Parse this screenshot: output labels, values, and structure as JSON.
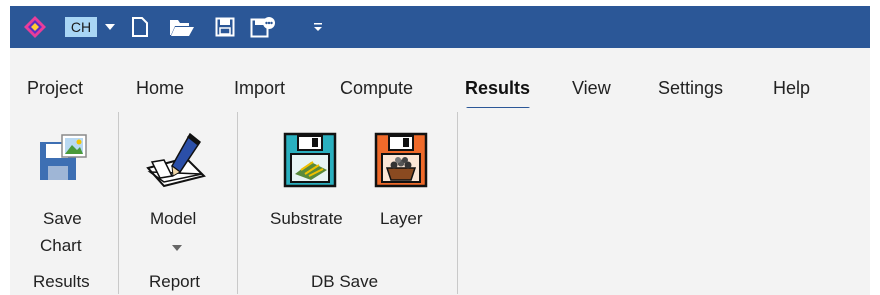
{
  "quick_access": {
    "profile_badge": "CH",
    "icons": [
      "app-logo-icon",
      "profile-badge",
      "dropdown-arrow-icon",
      "new-file-icon",
      "open-folder-icon",
      "save-icon",
      "save-remote-icon",
      "customize-toolbar-icon"
    ]
  },
  "menu": {
    "tabs": [
      "Project",
      "Home",
      "Import",
      "Compute",
      "Results",
      "View",
      "Settings",
      "Help"
    ],
    "active": "Results"
  },
  "ribbon": {
    "groups": [
      {
        "name": "Results",
        "buttons": [
          {
            "line1": "Save",
            "line2": "Chart",
            "icon": "save-chart-icon"
          }
        ]
      },
      {
        "name": "Report",
        "buttons": [
          {
            "line1": "Model",
            "icon": "notepad-pen-icon",
            "dropdown": true
          }
        ]
      },
      {
        "name": "DB Save",
        "buttons": [
          {
            "line1": "Substrate",
            "icon": "floppy-substrate-icon"
          },
          {
            "line1": "Layer",
            "icon": "floppy-layer-icon"
          }
        ]
      }
    ]
  },
  "colors": {
    "title_bar": "#2b5797",
    "ribbon_bg": "#f3f3f3",
    "accent_underline": "#2b5797",
    "badge_bg": "#a9d6f5"
  }
}
